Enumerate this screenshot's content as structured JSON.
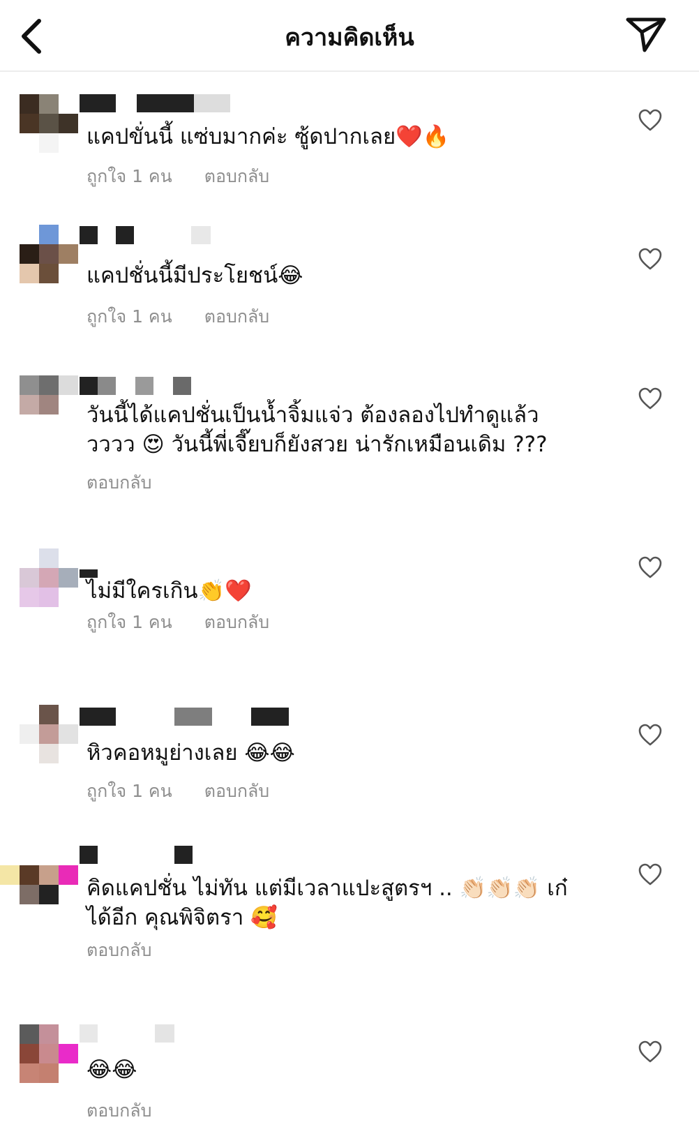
{
  "header": {
    "title": "ความคิดเห็น",
    "back_icon": "chevron-left-icon",
    "send_icon": "paper-plane-icon"
  },
  "comments": [
    {
      "text": "แคปขั่นนี้ แซ่บมากค่ะ ซู้ดปากเลย❤️🔥",
      "likes": "ถูกใจ 1 คน",
      "reply": "ตอบกลับ"
    },
    {
      "text": "แคปชั่นนี้มีประโยชน์😂",
      "likes": "ถูกใจ 1 คน",
      "reply": "ตอบกลับ"
    },
    {
      "text": "วันนี้ได้แคปชั่นเป็นน้ำจิ้มแจ่ว ต้องลองไปทำดูแล้ววววว 😍 วันนี้พี่เจี๊ยบก็ยังสวย น่ารักเหมือนเดิม ???",
      "likes": "",
      "reply": "ตอบกลับ"
    },
    {
      "text": "ไม่มีใครเกิน👏❤️",
      "likes": "ถูกใจ 1 คน",
      "reply": "ตอบกลับ"
    },
    {
      "text": "หิวคอหมูย่างเลย 😂😂",
      "likes": "ถูกใจ 1 คน",
      "reply": "ตอบกลับ"
    },
    {
      "text": "คิดแคปชั่น ไม่ทัน แต่มีเวลาแปะสูตรฯ .. 👏🏻👏🏻👏🏻 เก๋ได้อีก คุณพิจิตรา 🥰",
      "likes": "",
      "reply": "ตอบกลับ"
    },
    {
      "text": "😂😂",
      "likes": "",
      "reply": "ตอบกลับ"
    }
  ],
  "heart_icon": "heart-outline-icon",
  "colors": {
    "meta_text": "#8e8e8e",
    "divider": "#ececec",
    "text": "#111111"
  }
}
